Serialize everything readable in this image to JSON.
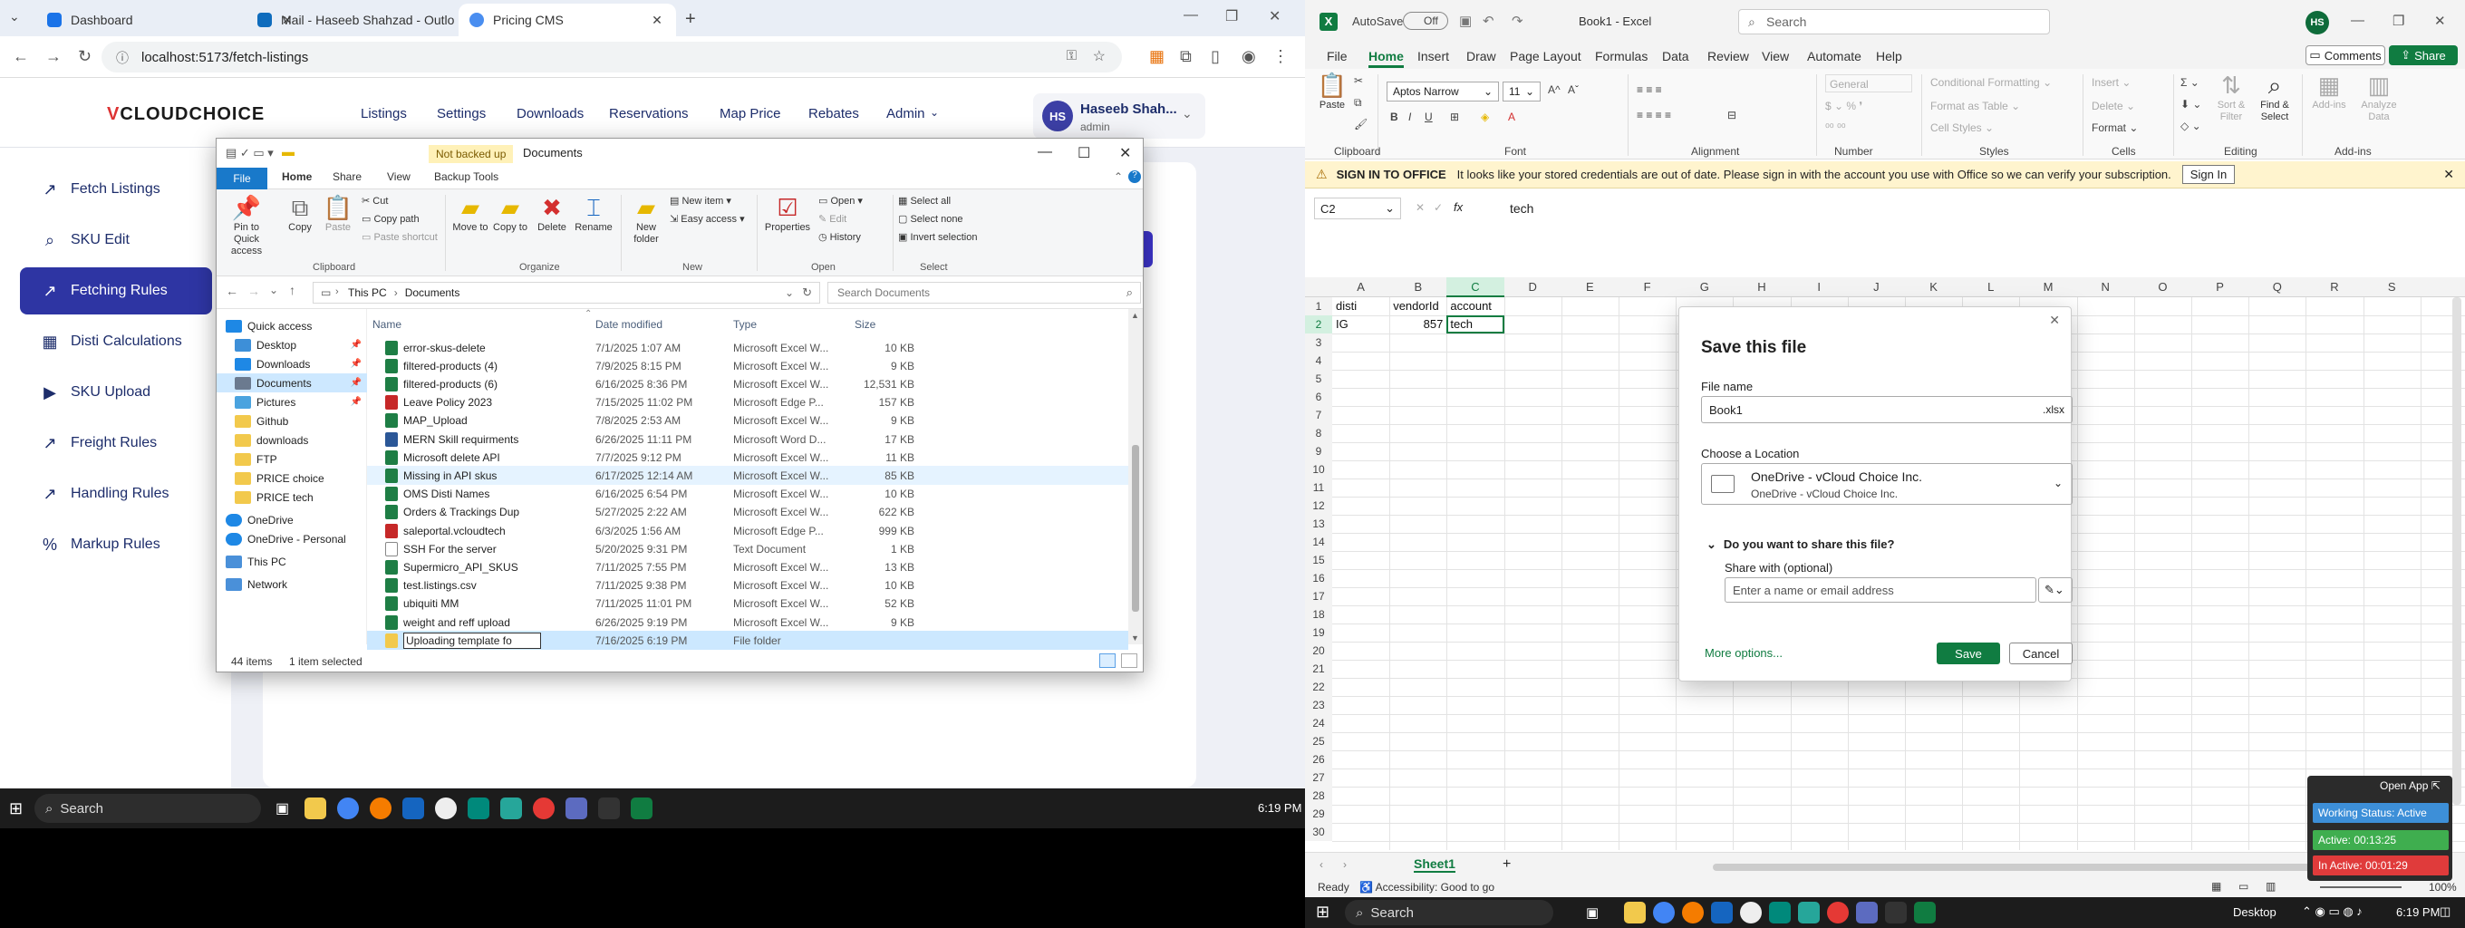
{
  "chrome": {
    "tabs": [
      {
        "label": "Dashboard",
        "color": "#1a73e8"
      },
      {
        "label": "Mail - Haseeb Shahzad - Outlo",
        "color": "#0f6cbd"
      },
      {
        "label": "Pricing CMS",
        "color": "#1a73e8"
      }
    ],
    "new_tab": "+",
    "url": "localhost:5173/fetch-listings",
    "min": "—",
    "restore": "❐",
    "close": "✕"
  },
  "web": {
    "logo_v": "V",
    "logo_rest": "CLOUDCHOICE",
    "nav": [
      "Listings",
      "Settings",
      "Downloads",
      "Reservations",
      "Map Price",
      "Rebates",
      "Admin"
    ],
    "admin_caret": "⌄",
    "user": {
      "initials": "HS",
      "name": "Haseeb Shah...",
      "role": "admin",
      "caret": "⌄"
    },
    "sidebar": [
      {
        "icon": "↗",
        "label": "Fetch Listings"
      },
      {
        "icon": "⌕",
        "label": "SKU Edit"
      },
      {
        "icon": "↗",
        "label": "Fetching Rules"
      },
      {
        "icon": "▦",
        "label": "Disti Calculations"
      },
      {
        "icon": "▶",
        "label": "SKU Upload"
      },
      {
        "icon": "↗",
        "label": "Freight Rules"
      },
      {
        "icon": "↗",
        "label": "Handling Rules"
      },
      {
        "icon": "%",
        "label": "Markup Rules"
      }
    ],
    "active_index": 2
  },
  "explorer": {
    "not_backed_up": "Not backed up",
    "title": "Documents",
    "tabs": [
      "File",
      "Home",
      "Share",
      "View",
      "Backup Tools"
    ],
    "ribbon": {
      "pin": "Pin to Quick access",
      "copy": "Copy",
      "paste": "Paste",
      "cut": "Cut",
      "copy_path": "Copy path",
      "paste_shortcut": "Paste shortcut",
      "move_to": "Move to",
      "copy_to": "Copy to",
      "delete": "Delete",
      "rename": "Rename",
      "new_folder": "New folder",
      "new_item": "New item",
      "easy_access": "Easy access",
      "properties": "Properties",
      "open": "Open",
      "edit": "Edit",
      "history": "History",
      "select_all": "Select all",
      "select_none": "Select none",
      "invert_selection": "Invert selection",
      "groups": [
        "Clipboard",
        "Organize",
        "New",
        "Open",
        "Select"
      ]
    },
    "breadcrumb": [
      "This PC",
      "Documents"
    ],
    "search_placeholder": "Search Documents",
    "nav": [
      {
        "label": "Quick access",
        "kind": "star",
        "pin": false
      },
      {
        "label": "Desktop",
        "kind": "desktop",
        "pin": true
      },
      {
        "label": "Downloads",
        "kind": "download",
        "pin": true
      },
      {
        "label": "Documents",
        "kind": "docs",
        "pin": true
      },
      {
        "label": "Pictures",
        "kind": "pics",
        "pin": true
      },
      {
        "label": "Github",
        "kind": "folder",
        "pin": false
      },
      {
        "label": "downloads",
        "kind": "folder",
        "pin": false
      },
      {
        "label": "FTP",
        "kind": "folder",
        "pin": false
      },
      {
        "label": "PRICE choice",
        "kind": "folder",
        "pin": false
      },
      {
        "label": "PRICE tech",
        "kind": "folder",
        "pin": false
      },
      {
        "label": "OneDrive",
        "kind": "cloud",
        "pin": false
      },
      {
        "label": "OneDrive - Personal",
        "kind": "cloud",
        "pin": false
      },
      {
        "label": "This PC",
        "kind": "pc",
        "pin": false
      },
      {
        "label": "Network",
        "kind": "net",
        "pin": false
      }
    ],
    "columns": [
      "Name",
      "Date modified",
      "Type",
      "Size"
    ],
    "files": [
      {
        "name": "error-skus-delete",
        "date": "7/1/2025 1:07 AM",
        "type": "Microsoft Excel W...",
        "size": "10 KB",
        "kind": "x"
      },
      {
        "name": "filtered-products (4)",
        "date": "7/9/2025 8:15 PM",
        "type": "Microsoft Excel W...",
        "size": "9 KB",
        "kind": "x"
      },
      {
        "name": "filtered-products (6)",
        "date": "6/16/2025 8:36 PM",
        "type": "Microsoft Excel W...",
        "size": "12,531 KB",
        "kind": "x"
      },
      {
        "name": "Leave Policy 2023",
        "date": "7/15/2025 11:02 PM",
        "type": "Microsoft Edge P...",
        "size": "157 KB",
        "kind": "p"
      },
      {
        "name": "MAP_Upload",
        "date": "7/8/2025 2:53 AM",
        "type": "Microsoft Excel W...",
        "size": "9 KB",
        "kind": "x"
      },
      {
        "name": "MERN Skill requirments",
        "date": "6/26/2025 11:11 PM",
        "type": "Microsoft Word D...",
        "size": "17 KB",
        "kind": "w"
      },
      {
        "name": "Microsoft delete API",
        "date": "7/7/2025 9:12 PM",
        "type": "Microsoft Excel W...",
        "size": "11 KB",
        "kind": "x"
      },
      {
        "name": "Missing in API skus",
        "date": "6/17/2025 12:14 AM",
        "type": "Microsoft Excel W...",
        "size": "85 KB",
        "kind": "x",
        "hover": true
      },
      {
        "name": "OMS Disti Names",
        "date": "6/16/2025 6:54 PM",
        "type": "Microsoft Excel W...",
        "size": "10 KB",
        "kind": "x"
      },
      {
        "name": "Orders & Trackings Dup",
        "date": "5/27/2025 2:22 AM",
        "type": "Microsoft Excel W...",
        "size": "622 KB",
        "kind": "x"
      },
      {
        "name": "saleportal.vcloudtech",
        "date": "6/3/2025 1:56 AM",
        "type": "Microsoft Edge P...",
        "size": "999 KB",
        "kind": "p"
      },
      {
        "name": "SSH For the server",
        "date": "5/20/2025 9:31 PM",
        "type": "Text Document",
        "size": "1 KB",
        "kind": "t"
      },
      {
        "name": "Supermicro_API_SKUS",
        "date": "7/11/2025 7:55 PM",
        "type": "Microsoft Excel W...",
        "size": "13 KB",
        "kind": "x"
      },
      {
        "name": "test.listings.csv",
        "date": "7/11/2025 9:38 PM",
        "type": "Microsoft Excel W...",
        "size": "10 KB",
        "kind": "x"
      },
      {
        "name": "ubiquiti MM",
        "date": "7/11/2025 11:01 PM",
        "type": "Microsoft Excel W...",
        "size": "52 KB",
        "kind": "x"
      },
      {
        "name": "weight and reff upload",
        "date": "6/26/2025 9:19 PM",
        "type": "Microsoft Excel W...",
        "size": "9 KB",
        "kind": "x"
      }
    ],
    "rename_row": {
      "value": "Uploading template fo",
      "date": "7/16/2025 6:19 PM",
      "type": "File folder"
    },
    "status_items": "44 items",
    "status_selected": "1 item selected"
  },
  "taskbar_left": {
    "search": "Search",
    "time": "6:19 PM"
  },
  "excel": {
    "autosave": "AutoSave",
    "autosave_state": "Off",
    "doc_title": "Book1 - Excel",
    "search": "Search",
    "user_initials": "HS",
    "menu": [
      "File",
      "Home",
      "Insert",
      "Draw",
      "Page Layout",
      "Formulas",
      "Data",
      "Review",
      "View",
      "Automate",
      "Help"
    ],
    "comments": "Comments",
    "share": "Share",
    "ribbon": {
      "paste": "Paste",
      "font_name": "Aptos Narrow",
      "font_size": "11",
      "number_format": "General",
      "conditional": "Conditional Formatting",
      "format_table": "Format as Table",
      "cell_styles": "Cell Styles",
      "insert": "Insert",
      "delete": "Delete",
      "format": "Format",
      "sort": "Sort & Filter",
      "find": "Find & Select",
      "addins": "Add-ins",
      "analyze": "Analyze Data",
      "groups": [
        "Clipboard",
        "Font",
        "Alignment",
        "Number",
        "Styles",
        "Cells",
        "Editing",
        "Add-ins"
      ]
    },
    "msg_title": "SIGN IN TO OFFICE",
    "msg_text": "It looks like your stored credentials are out of date. Please sign in with the account you use with Office so we can verify your subscription.",
    "msg_btn": "Sign In",
    "namebox": "C2",
    "fx": "fx",
    "formula": "tech",
    "columns": [
      "A",
      "B",
      "C",
      "D",
      "E",
      "F",
      "G",
      "H",
      "I",
      "J",
      "K",
      "L",
      "M",
      "N",
      "O",
      "P",
      "Q",
      "R",
      "S"
    ],
    "rows": 30,
    "cells": {
      "A1": "disti",
      "B1": "vendorId",
      "C1": "account",
      "A2": "IG",
      "B2": "857",
      "C2": "tech"
    },
    "sheet": "Sheet1",
    "status_ready": "Ready",
    "status_access": "Accessibility: Good to go",
    "zoom": "100%",
    "save_dialog": {
      "title": "Save this file",
      "file_name_label": "File name",
      "file_name": "Book1",
      "ext": ".xlsx",
      "location_label": "Choose a Location",
      "location_main": "OneDrive - vCloud Choice Inc.",
      "location_sub": "OneDrive - vCloud Choice Inc.",
      "share_q": "Do you want to share this file?",
      "share_with": "Share with (optional)",
      "share_placeholder": "Enter a name or email address",
      "more": "More options...",
      "save": "Save",
      "cancel": "Cancel"
    }
  },
  "timer": {
    "open_app": "Open App",
    "working": "Working Status: Active",
    "active": "Active: 00:13:25",
    "inactive": "In Active: 00:01:29"
  },
  "taskbar_right": {
    "search": "Search",
    "desktop": "Desktop",
    "time": "6:19 PM"
  }
}
